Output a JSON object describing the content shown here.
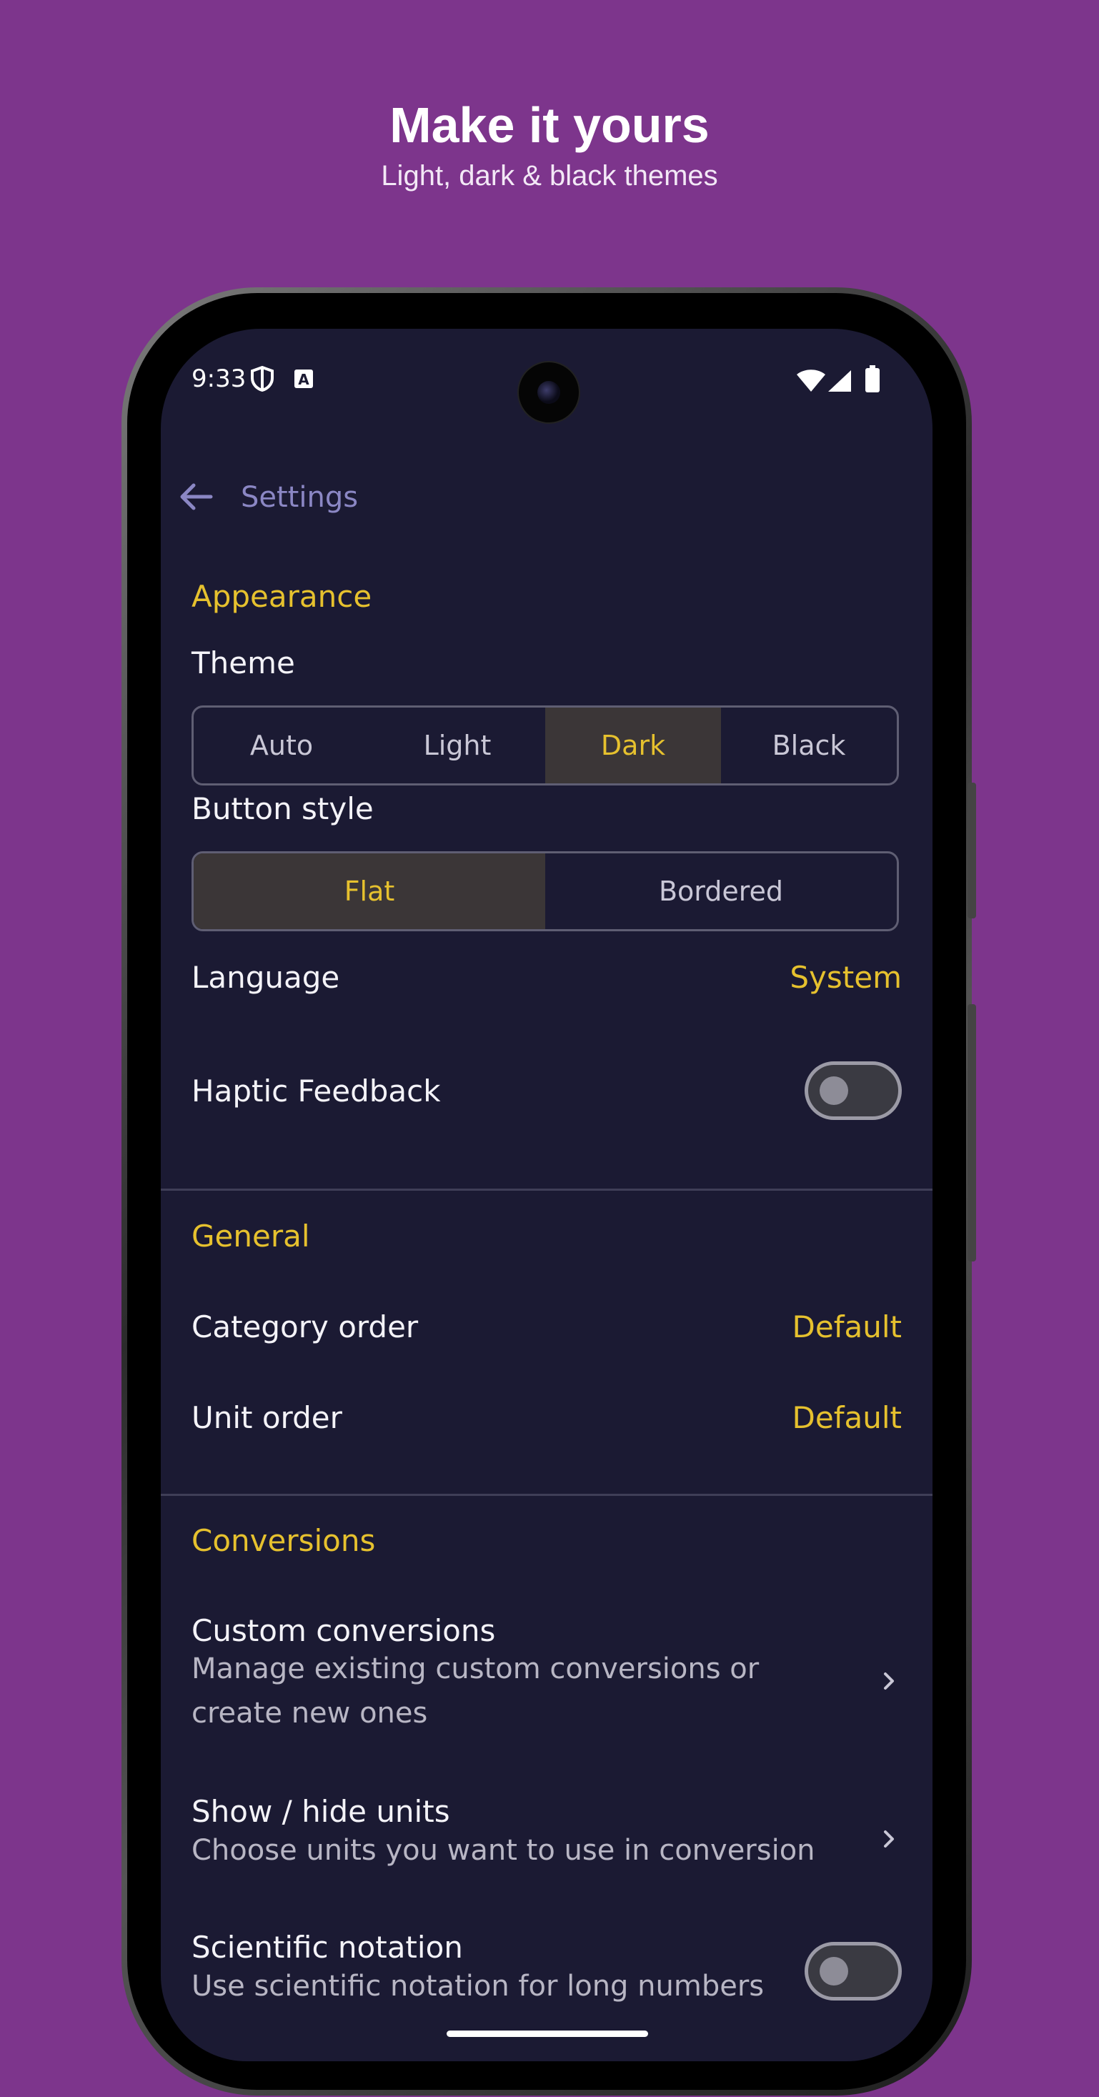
{
  "hero": {
    "title": "Make it yours",
    "subtitle": "Light, dark & black themes"
  },
  "status_bar": {
    "time": "9:33",
    "icons": [
      "shield-icon",
      "a-notification-icon",
      "wifi-icon",
      "cellular-signal-icon",
      "battery-icon"
    ]
  },
  "app_bar": {
    "title": "Settings",
    "back_icon": "arrow-back-icon"
  },
  "appearance": {
    "header": "Appearance",
    "theme": {
      "label": "Theme",
      "options": [
        "Auto",
        "Light",
        "Dark",
        "Black"
      ],
      "selected": "Dark"
    },
    "button_style": {
      "label": "Button style",
      "options": [
        "Flat",
        "Bordered"
      ],
      "selected": "Flat"
    },
    "language": {
      "label": "Language",
      "value": "System"
    },
    "haptic": {
      "label": "Haptic Feedback",
      "enabled": false
    }
  },
  "general": {
    "header": "General",
    "category_order": {
      "label": "Category order",
      "value": "Default"
    },
    "unit_order": {
      "label": "Unit order",
      "value": "Default"
    }
  },
  "conversions": {
    "header": "Conversions",
    "custom": {
      "label": "Custom conversions",
      "sub_line1": "Manage existing custom conversions or",
      "sub_line2": "create new ones"
    },
    "show_hide": {
      "label": "Show / hide units",
      "sub": "Choose units you want to use in conversion"
    },
    "scientific": {
      "label": "Scientific notation",
      "sub": "Use scientific notation for long numbers",
      "enabled": false
    }
  },
  "colors": {
    "background": "#7d358c",
    "screen": "#1b1a33",
    "accent": "#e6c12e",
    "selected_segment": "#3b3637"
  }
}
